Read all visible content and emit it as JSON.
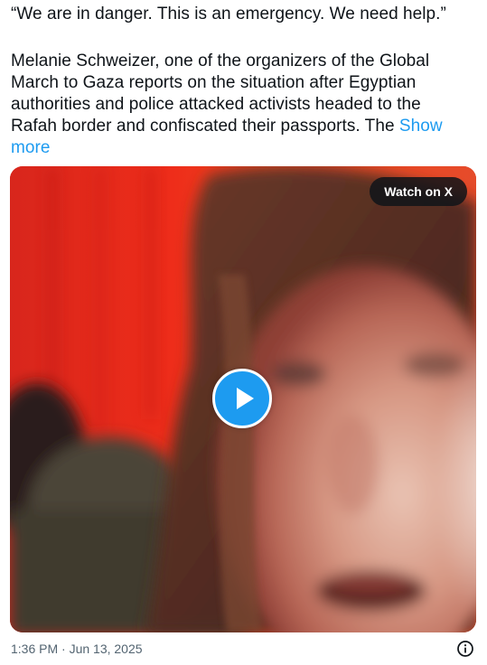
{
  "tweet": {
    "quote": "“We are in danger. This is an emergency. We need help.”",
    "body": "Melanie Schweizer, one of the organizers of the Global March to Gaza reports on the situation after Egyptian authorities and police attacked activists headed to the Rafah border and confiscated their passports. The ",
    "show_more": "Show more",
    "timestamp": "1:36 PM · Jun 13, 2025"
  },
  "media": {
    "watch_label": "Watch on X",
    "play_icon": "play-icon"
  },
  "icons": {
    "info": "info-icon"
  },
  "colors": {
    "link": "#1d9bf0",
    "text": "#0f1419",
    "muted": "#536471",
    "play": "#1d9bf0"
  }
}
